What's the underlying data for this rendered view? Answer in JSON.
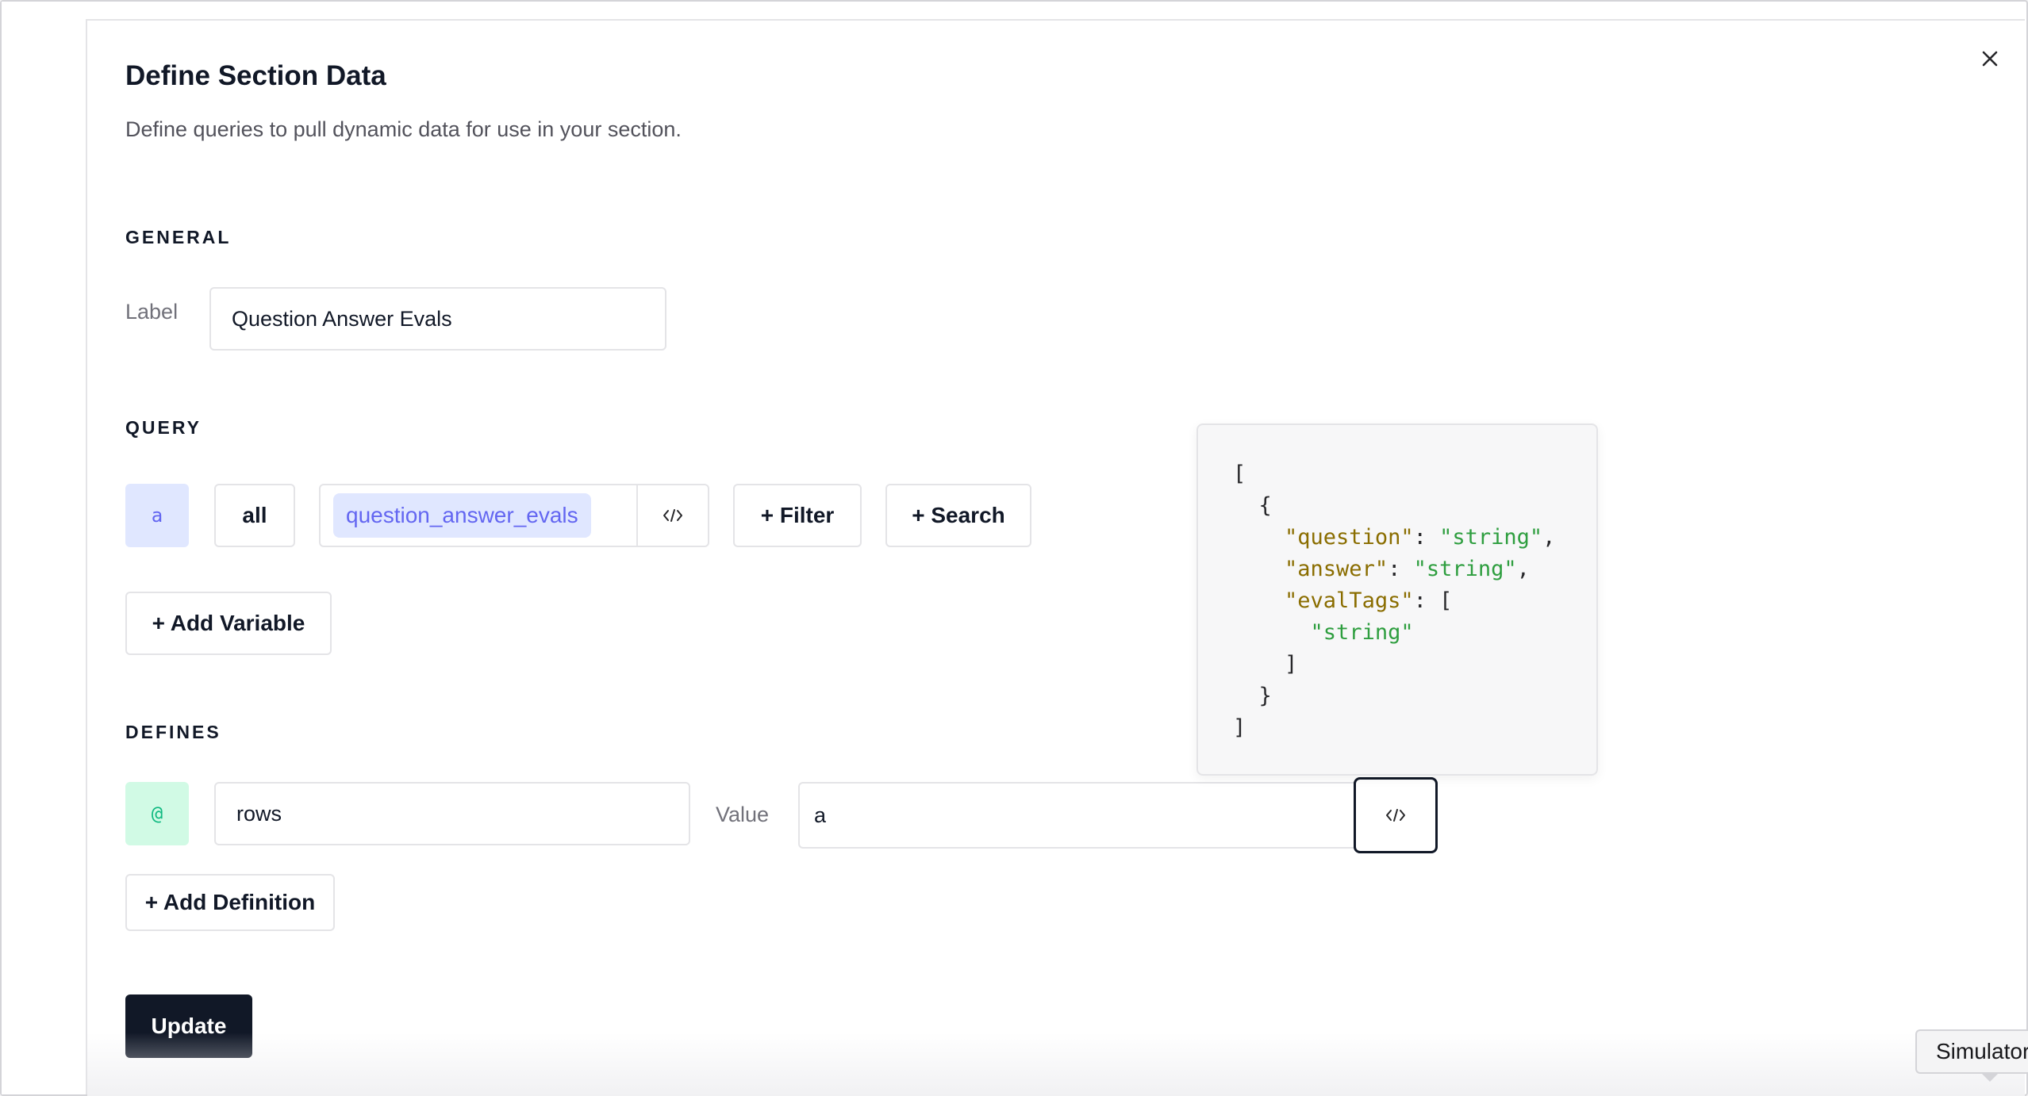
{
  "modal": {
    "title": "Define Section Data",
    "subtitle": "Define queries to pull dynamic data for use in your section.",
    "close_icon": "close-icon"
  },
  "general": {
    "heading": "GENERAL",
    "label_caption": "Label",
    "label_value": "Question Answer Evals"
  },
  "query": {
    "heading": "QUERY",
    "alias": "a",
    "scope": "all",
    "table": "question_answer_evals",
    "code_icon": "code-icon",
    "filter_label": "+ Filter",
    "search_label": "+ Search",
    "add_variable_label": "+ Add Variable"
  },
  "defines": {
    "heading": "DEFINES",
    "prefix": "@",
    "name_value": "rows",
    "value_caption": "Value",
    "value_value": "a",
    "code_icon": "code-icon",
    "add_definition_label": "+ Add Definition"
  },
  "schema_preview": {
    "open_bracket": "[",
    "open_brace": "{",
    "fields": [
      {
        "key": "\"question\"",
        "value": "\"string\""
      },
      {
        "key": "\"answer\"",
        "value": "\"string\""
      },
      {
        "key": "\"evalTags\"",
        "open": "[",
        "item": "\"string\"",
        "close": "]"
      }
    ],
    "close_brace": "}",
    "close_bracket": "]"
  },
  "actions": {
    "update_label": "Update"
  },
  "tooltip": {
    "label": "Simulator"
  },
  "colors": {
    "primary_button": "#111827",
    "alias_badge_bg": "#e0e7ff",
    "alias_badge_fg": "#6366f1",
    "define_badge_bg": "#d1fae5",
    "define_badge_fg": "#10b981",
    "json_key": "#8a6d00",
    "json_string": "#2e9e3f"
  }
}
